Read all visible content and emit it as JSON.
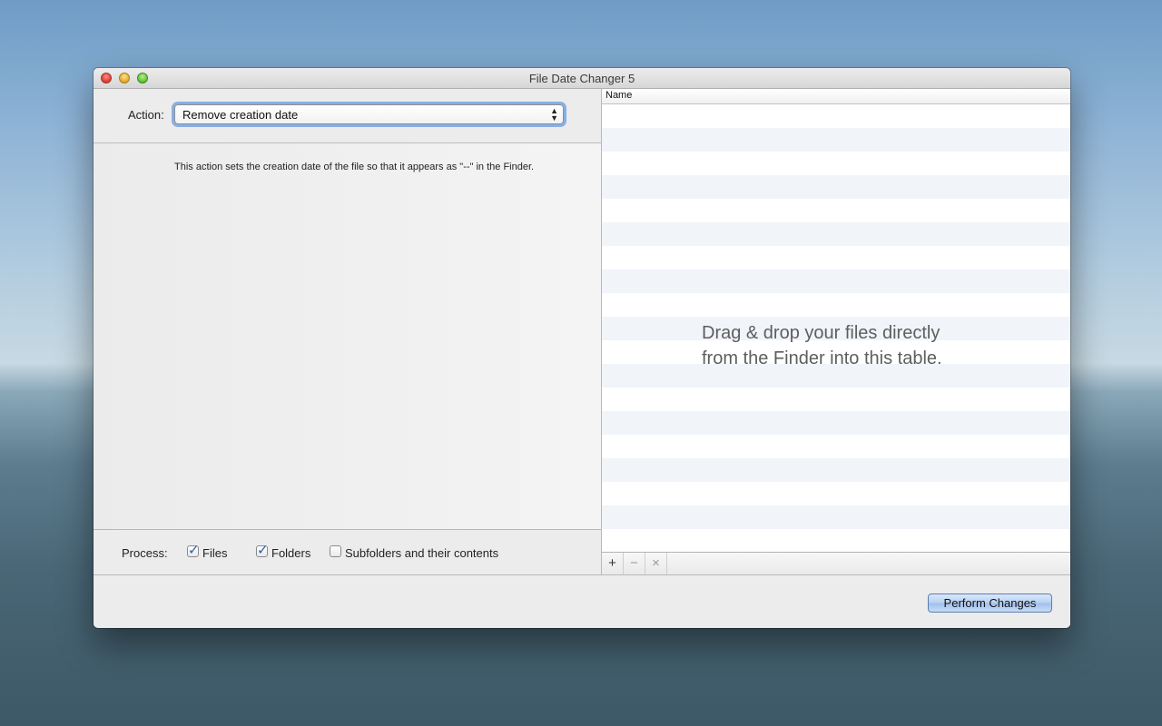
{
  "window": {
    "title": "File Date Changer 5"
  },
  "action": {
    "label": "Action:",
    "selected": "Remove creation date",
    "description": "This action sets the creation date of the file so that it appears as \"--\" in the Finder."
  },
  "process": {
    "label": "Process:",
    "options": [
      {
        "label": "Files",
        "checked": true
      },
      {
        "label": "Folders",
        "checked": true
      },
      {
        "label": "Subfolders and their contents",
        "checked": false
      }
    ]
  },
  "table": {
    "column_name": "Name",
    "drop_hint_line1": "Drag & drop your files directly",
    "drop_hint_line2": "from the Finder into this table.",
    "tools": {
      "add": "+",
      "remove": "−",
      "clear": "×"
    }
  },
  "footer": {
    "perform_label": "Perform Changes"
  }
}
